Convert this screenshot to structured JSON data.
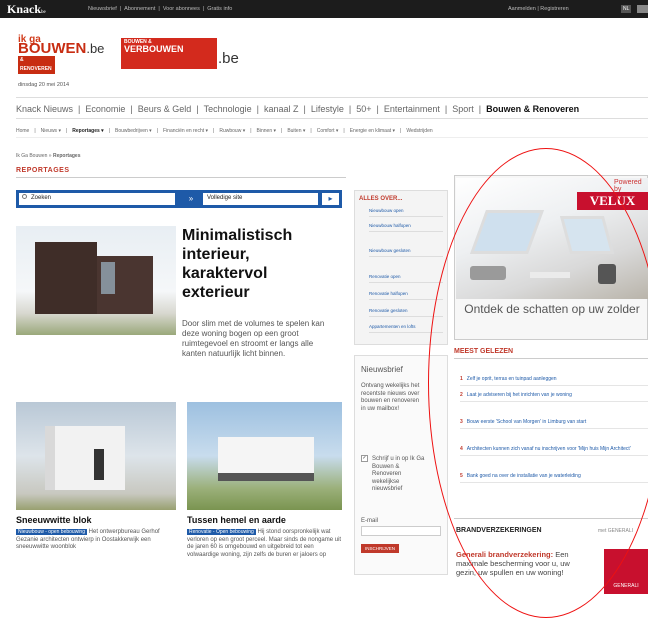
{
  "topbar": {
    "brand": "Knack",
    "brand_sub": "be",
    "links": [
      "Nieuwsbrief",
      "|",
      "Abonnement",
      "|",
      "Voor abonnees",
      "|",
      "Gratis info"
    ],
    "login": "Aanmelden | Registreren",
    "lang": "NL"
  },
  "logo1": {
    "line1": "ik ga",
    "line2": "BOUWEN",
    "suffix": ".be",
    "sub": "& RENOVEREN"
  },
  "logo2": {
    "top": "BOUWEN &",
    "bottom": "VERBOUWEN",
    "suffix": ".be"
  },
  "date": "dinsdag 20 mei 2014",
  "mainnav": {
    "items": [
      "Knack Nieuws",
      "|",
      "Economie",
      "|",
      "Beurs & Geld",
      "|",
      "Technologie",
      "|",
      "kanaal Z",
      "|",
      "Lifestyle",
      "|",
      "50+",
      "|",
      "Entertainment",
      "|",
      "Sport",
      "|"
    ],
    "active": "Bouwen & Renoveren"
  },
  "subnav": {
    "items": [
      "Home",
      "|",
      "Nieuws ▾",
      "|"
    ],
    "active": "Reportages ▾",
    "items2": [
      "|",
      "Bouwbedrijven ▾",
      "|",
      "Financiën en recht ▾",
      "|",
      "Ruwbouw ▾",
      "|",
      "Binnen ▾",
      "|",
      "Buiten ▾",
      "|",
      "Comfort ▾",
      "|",
      "Energie en klimaat ▾",
      "|",
      "Wedstrijden"
    ]
  },
  "breadcrumb": {
    "home": "Ik Ga Bouwen",
    "sep": " » ",
    "current": "Reportages"
  },
  "section_title": "REPORTAGES",
  "search": {
    "placeholder": "Zoeken",
    "go": "»",
    "scope": "Volledige site",
    "arrow": "▸"
  },
  "hero": {
    "title": "Minimalistisch interieur, karaktervol exterieur",
    "text": "Door slim met de volumes te spelen kan deze woning bogen op een groot ruimtegevoel en stroomt er langs alle kanten natuurlijk licht binnen."
  },
  "cards": [
    {
      "title": "Sneeuwwitte blok",
      "tag": "Nieuwbouw - open bebouwing",
      "text": "Het ontwerpbureau Gerhof Gezanie architecten ontwierp in Oostakkerwijk een sneeuwwitte woonblok"
    },
    {
      "title": "Tussen hemel en aarde",
      "tag": "Renovatie - Open bebouwing",
      "text": "Hij stond oorspronkelijk wat verloren op een groot perceel. Maar sinds de nongame uit de jaren 60 is omgebouwd en uitgebreid tot een volwaardige woning, zijn zelfs de buren er jaloers op"
    }
  ],
  "alles": {
    "header": "ALLES OVER...",
    "items": [
      "Nieuwbouw open",
      "Nieuwbouw halfopen",
      "Nieuwbouw gesloten",
      "Renovatie open",
      "Renovatie halfopen",
      "Renovatie gesloten",
      "Appartementen en lofts"
    ]
  },
  "newsletter": {
    "header": "Nieuwsbrief",
    "text": "Ontvang wekelijks het recentste nieuws over bouwen en renoveren in uw mailbox!",
    "check": "✓",
    "checkbox_label": "Schrijf u in op Ik Ga Bouwen & Renoveren wekelijkse nieuwsbrief",
    "email_label": "E-mail",
    "submit": "INSCHRIJVEN"
  },
  "ad": {
    "powered": "Powered by",
    "brand": "VELUX",
    "text": "Ontdek de schatten op uw zolder"
  },
  "meest": {
    "header": "MEEST GELEZEN",
    "items": [
      {
        "n": "1",
        "t": "Zelf je oprit, terras en tuinpad aanleggen"
      },
      {
        "n": "2",
        "t": "Laat je adviseren bij het inrichten van je woning"
      },
      {
        "n": "3",
        "t": "Bouw eerste 'School van Morgen' in Limburg van start"
      },
      {
        "n": "4",
        "t": "Architecten kunnen zich vanaf nu inschrijven voor 'Mijn huis Mijn Architect'"
      },
      {
        "n": "5",
        "t": "Bank goed na over de installatie van je waterleiding"
      }
    ]
  },
  "brand": {
    "header": "BRANDVERZEKERINGEN",
    "partner": "met GENERALI",
    "text_b": "Generali brandverzekering:",
    "text": "Een maximale bescherming voor u, uw gezin, uw spullen en uw woning!",
    "logo": "GENERALI"
  },
  "accent": {
    "red": "#c0392b",
    "blue": "#1e5aa8",
    "velux": "#c8102e",
    "annotation": "#e11"
  }
}
